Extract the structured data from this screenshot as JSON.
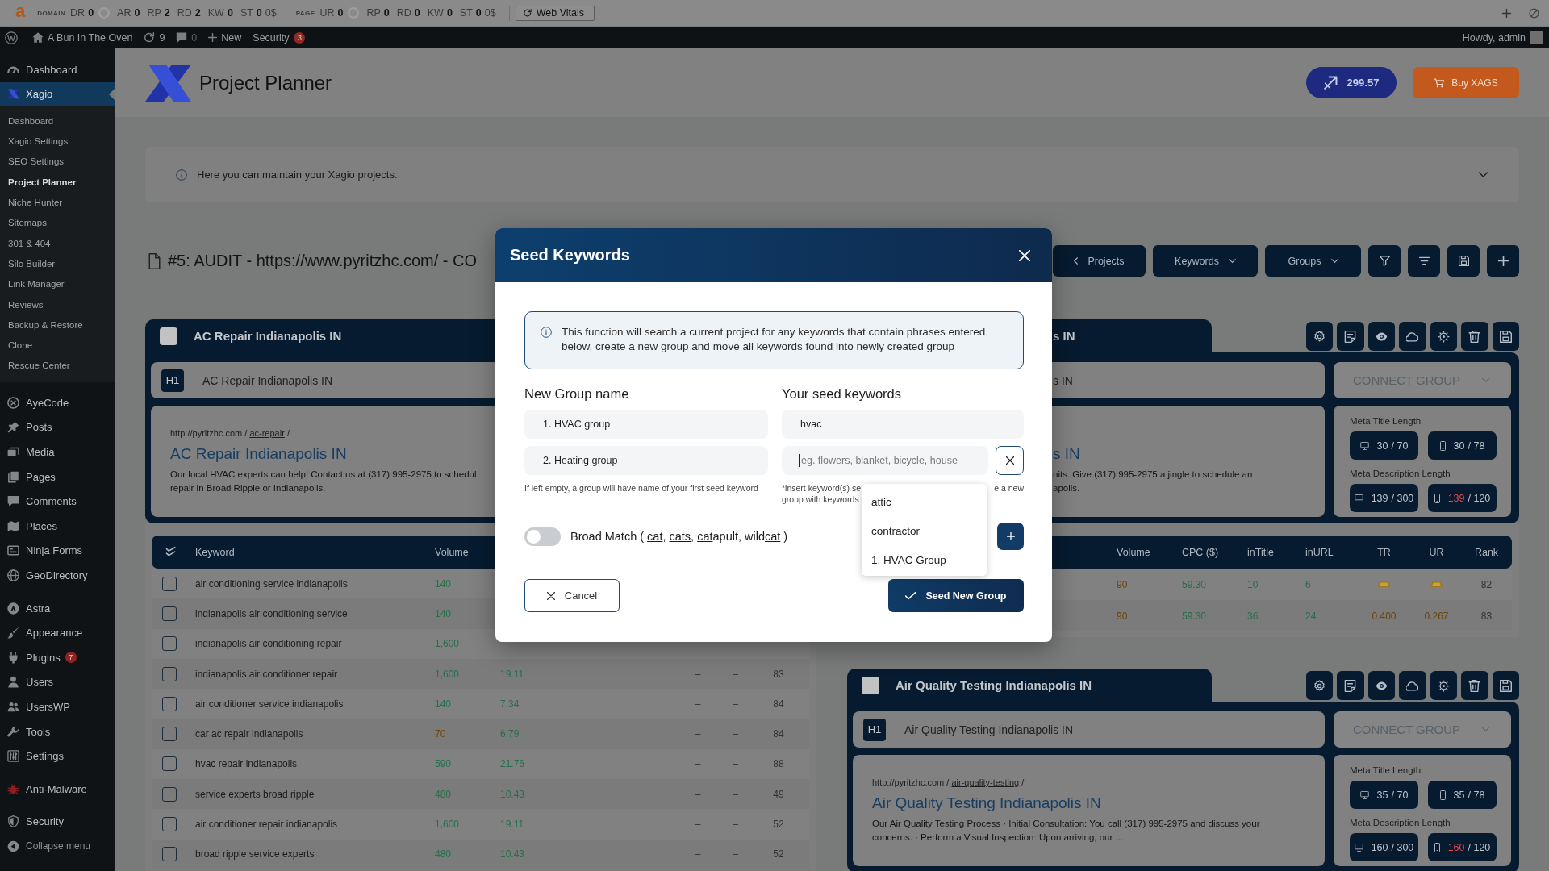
{
  "toolbar": {
    "logo": "a",
    "groups": [
      {
        "label": "DOMAIN",
        "score": {
          "label": "DR",
          "value": "0"
        },
        "metrics": [
          {
            "label": "AR",
            "value": "0"
          },
          {
            "label": "RP",
            "value": "2"
          },
          {
            "label": "RD",
            "value": "2"
          },
          {
            "label": "KW",
            "value": "0"
          },
          {
            "label": "ST",
            "value": "0",
            "extra": "0$"
          }
        ]
      },
      {
        "label": "PAGE",
        "score": {
          "label": "UR",
          "value": "0"
        },
        "metrics": [
          {
            "label": "RP",
            "value": "0"
          },
          {
            "label": "RD",
            "value": "0"
          },
          {
            "label": "KW",
            "value": "0"
          },
          {
            "label": "ST",
            "value": "0",
            "extra": "0$"
          }
        ]
      }
    ],
    "web_vitals": "Web Vitals"
  },
  "admin_bar": {
    "site": "A Bun In The Oven",
    "updates": "9",
    "comments": "0",
    "new": "New",
    "security": "Security",
    "security_count": "3",
    "greeting": "Howdy, admin"
  },
  "sidebar": {
    "groups": [
      [
        {
          "label": "Dashboard",
          "selected": false
        },
        {
          "label": "Xagio",
          "selected": true,
          "children": [
            {
              "label": "Dashboard",
              "selected": false
            },
            {
              "label": "Xagio Settings",
              "selected": false
            },
            {
              "label": "SEO Settings",
              "selected": false
            },
            {
              "label": "Project Planner",
              "selected": true
            },
            {
              "label": "Niche Hunter",
              "selected": false
            },
            {
              "label": "Sitemaps",
              "selected": false
            },
            {
              "label": "301 & 404",
              "selected": false
            },
            {
              "label": "Silo Builder",
              "selected": false
            },
            {
              "label": "Link Manager",
              "selected": false
            },
            {
              "label": "Reviews",
              "selected": false
            },
            {
              "label": "Backup & Restore",
              "selected": false
            },
            {
              "label": "Clone",
              "selected": false
            },
            {
              "label": "Rescue Center",
              "selected": false
            }
          ]
        }
      ],
      [
        {
          "label": "AyeCode",
          "selected": false
        },
        {
          "label": "Posts",
          "selected": false
        },
        {
          "label": "Media",
          "selected": false
        },
        {
          "label": "Pages",
          "selected": false
        },
        {
          "label": "Comments",
          "selected": false
        },
        {
          "label": "Places",
          "selected": false
        },
        {
          "label": "Ninja Forms",
          "selected": false
        },
        {
          "label": "GeoDirectory",
          "selected": false
        }
      ],
      [
        {
          "label": "Astra",
          "selected": false
        },
        {
          "label": "Appearance",
          "selected": false
        },
        {
          "label": "Plugins",
          "selected": false,
          "badge": "7"
        },
        {
          "label": "Users",
          "selected": false
        },
        {
          "label": "UsersWP",
          "selected": false
        },
        {
          "label": "Tools",
          "selected": false
        },
        {
          "label": "Settings",
          "selected": false
        }
      ],
      [
        {
          "label": "Anti-Malware",
          "selected": false
        }
      ],
      [
        {
          "label": "Security",
          "selected": false
        }
      ]
    ],
    "collapse": "Collapse menu"
  },
  "header": {
    "title": "Project Planner",
    "balance": "299.57",
    "buy": "Buy XAGS"
  },
  "notice": {
    "text": "Here you can maintain your Xagio projects."
  },
  "project": {
    "title": "#5: AUDIT - https://www.pyritzhc.com/ - CO",
    "buttons": [
      "Projects",
      "Keywords",
      "Groups"
    ]
  },
  "project_columns": [
    {
      "cards": [
        {
          "title": "AC Repair Indianapolis IN",
          "checked": false,
          "h1_badge": "H1",
          "h1": "AC Repair Indianapolis IN",
          "url": [
            {
              "text": "http://pyritzhc.com / ",
              "underlined": false
            },
            {
              "text": "ac-repair",
              "underlined": true
            },
            {
              "text": " /",
              "underlined": false
            }
          ],
          "snippet_title": "AC Repair Indianapolis IN",
          "description_lines": [
            "Our local HVAC experts can help! Contact us at (317) 995-2975 to schedul",
            "repair in Broad Ripple or Indianapolis."
          ],
          "keywords_table": {
            "columns": [
              "Keyword",
              "Volume"
            ],
            "rows": [
              {
                "checked": false,
                "cells": [
                  {
                    "kind": "text",
                    "text": "air conditioning service indianapolis"
                  },
                  {
                    "kind": "text",
                    "text": "140",
                    "color": "#24704a"
                  }
                ]
              },
              {
                "checked": false,
                "cells": [
                  {
                    "kind": "text",
                    "text": "indianapolis air conditioning service"
                  },
                  {
                    "kind": "text",
                    "text": "140",
                    "color": "#24704a"
                  }
                ]
              },
              {
                "checked": false,
                "cells": [
                  {
                    "kind": "text",
                    "text": "indianapolis air conditioning repair"
                  },
                  {
                    "kind": "text",
                    "text": "1,600",
                    "color": "#24704a"
                  }
                ]
              },
              {
                "checked": false,
                "cells": [
                  {
                    "kind": "text",
                    "text": "indianapolis air conditioner repair"
                  },
                  {
                    "kind": "text",
                    "text": "1,600",
                    "color": "#24704a"
                  },
                  {
                    "kind": "text",
                    "text": "19.11",
                    "color": "#24704a"
                  },
                  {
                    "kind": "text",
                    "text": "–"
                  },
                  {
                    "kind": "text",
                    "text": "–"
                  },
                  {
                    "kind": "text",
                    "text": "83"
                  }
                ]
              },
              {
                "checked": false,
                "cells": [
                  {
                    "kind": "text",
                    "text": "air conditioner service indianapolis"
                  },
                  {
                    "kind": "text",
                    "text": "140",
                    "color": "#24704a"
                  },
                  {
                    "kind": "text",
                    "text": "7.34",
                    "color": "#24704a"
                  },
                  {
                    "kind": "text",
                    "text": "–"
                  },
                  {
                    "kind": "text",
                    "text": "–"
                  },
                  {
                    "kind": "text",
                    "text": "84"
                  }
                ]
              },
              {
                "checked": false,
                "cells": [
                  {
                    "kind": "text",
                    "text": "car ac repair indianapolis"
                  },
                  {
                    "kind": "text",
                    "text": "70",
                    "color": "#6e4306"
                  },
                  {
                    "kind": "text",
                    "text": "6.79",
                    "color": "#24704a"
                  },
                  {
                    "kind": "text",
                    "text": "–"
                  },
                  {
                    "kind": "text",
                    "text": "–"
                  },
                  {
                    "kind": "text",
                    "text": "84"
                  }
                ]
              },
              {
                "checked": false,
                "cells": [
                  {
                    "kind": "text",
                    "text": "hvac repair indianapolis"
                  },
                  {
                    "kind": "text",
                    "text": "590",
                    "color": "#24704a"
                  },
                  {
                    "kind": "text",
                    "text": "21.76",
                    "color": "#24704a"
                  },
                  {
                    "kind": "text",
                    "text": "–"
                  },
                  {
                    "kind": "text",
                    "text": "–"
                  },
                  {
                    "kind": "text",
                    "text": "88"
                  }
                ]
              },
              {
                "checked": false,
                "cells": [
                  {
                    "kind": "text",
                    "text": "service experts broad ripple"
                  },
                  {
                    "kind": "text",
                    "text": "480",
                    "color": "#24704a"
                  },
                  {
                    "kind": "text",
                    "text": "10.43",
                    "color": "#24704a"
                  },
                  {
                    "kind": "text",
                    "text": "–"
                  },
                  {
                    "kind": "text",
                    "text": "–"
                  },
                  {
                    "kind": "text",
                    "text": "49"
                  }
                ]
              },
              {
                "checked": false,
                "cells": [
                  {
                    "kind": "text",
                    "text": "air conditioner repair indianapolis"
                  },
                  {
                    "kind": "text",
                    "text": "1,600",
                    "color": "#24704a"
                  },
                  {
                    "kind": "text",
                    "text": "19.11",
                    "color": "#24704a"
                  },
                  {
                    "kind": "text",
                    "text": "–"
                  },
                  {
                    "kind": "text",
                    "text": "–"
                  },
                  {
                    "kind": "text",
                    "text": "52"
                  }
                ]
              },
              {
                "checked": false,
                "cells": [
                  {
                    "kind": "text",
                    "text": "broad ripple service experts"
                  },
                  {
                    "kind": "text",
                    "text": "480",
                    "color": "#24704a"
                  },
                  {
                    "kind": "text",
                    "text": "10.43",
                    "color": "#24704a"
                  },
                  {
                    "kind": "text",
                    "text": "–"
                  },
                  {
                    "kind": "text",
                    "text": "–"
                  },
                  {
                    "kind": "text",
                    "text": "52"
                  }
                ]
              }
            ]
          }
        }
      ]
    },
    {
      "cards": [
        {
          "title": "s IN",
          "h1": "s IN",
          "snippet_title": "s IN",
          "description_lines": [
            "nits. Give (317) 995-2975 a jingle to schedule an",
            "apolis."
          ],
          "connect_group": "CONNECT GROUP",
          "meta": [
            {
              "label": "Meta Title Length",
              "counts": [
                {
                  "value": "30",
                  "rest": "/ 70",
                  "over": false
                },
                {
                  "value": "30",
                  "rest": "/ 78",
                  "over": false
                }
              ]
            },
            {
              "label": "Meta Description Length",
              "counts": [
                {
                  "value": "139",
                  "rest": "/ 300",
                  "over": false
                },
                {
                  "value": "139",
                  "rest": "/ 120",
                  "over": true
                }
              ]
            }
          ],
          "keywords_table": {
            "columns": [
              "Volume",
              "CPC ($)",
              "inTitle",
              "inURL",
              "TR",
              "UR",
              "Rank"
            ],
            "rows": [
              {
                "cells": [
                  {
                    "kind": "text",
                    "text": "90",
                    "color": "#6e4306"
                  },
                  {
                    "kind": "text",
                    "text": "59.30",
                    "color": "#24704a"
                  },
                  {
                    "kind": "text",
                    "text": "10",
                    "color": "#24704a"
                  },
                  {
                    "kind": "text",
                    "text": "6",
                    "color": "#24704a"
                  },
                  {
                    "kind": "icon"
                  },
                  {
                    "kind": "icon"
                  },
                  {
                    "kind": "text",
                    "text": "82"
                  }
                ]
              },
              {
                "cells": [
                  {
                    "kind": "text",
                    "text": "90",
                    "color": "#6e4306"
                  },
                  {
                    "kind": "text",
                    "text": "59.30",
                    "color": "#24704a"
                  },
                  {
                    "kind": "text",
                    "text": "36",
                    "color": "#24704a"
                  },
                  {
                    "kind": "text",
                    "text": "24",
                    "color": "#24704a"
                  },
                  {
                    "kind": "text",
                    "text": "0.400",
                    "color": "#6e4306"
                  },
                  {
                    "kind": "text",
                    "text": "0.267",
                    "color": "#6e4306"
                  },
                  {
                    "kind": "text",
                    "text": "83"
                  }
                ]
              }
            ]
          }
        },
        {
          "title": "Air Quality Testing Indianapolis IN",
          "checked": false,
          "h1_badge": "H1",
          "h1": "Air Quality Testing Indianapolis IN",
          "url": [
            {
              "text": "http://pyritzhc.com / ",
              "underlined": false
            },
            {
              "text": "air-quality-testing",
              "underlined": true
            },
            {
              "text": " /",
              "underlined": false
            }
          ],
          "snippet_title": "Air Quality Testing Indianapolis IN",
          "description_lines": [
            "Our Air Quality Testing Process · Initial Consultation: You call (317) 995-2975 and discuss your",
            "concerns. · Perform a Visual Inspection: Upon arriving, our ..."
          ],
          "connect_group": "CONNECT GROUP",
          "meta": [
            {
              "label": "Meta Title Length",
              "counts": [
                {
                  "value": "35",
                  "rest": "/ 70",
                  "over": false
                },
                {
                  "value": "35",
                  "rest": "/ 78",
                  "over": false
                }
              ]
            },
            {
              "label": "Meta Description Length",
              "counts": [
                {
                  "value": "160",
                  "rest": "/ 300",
                  "over": false
                },
                {
                  "value": "160",
                  "rest": "/ 120",
                  "over": true
                }
              ]
            }
          ]
        }
      ]
    }
  ],
  "modal": {
    "title": "Seed Keywords",
    "info": "This function will search a current project for any keywords that contain phrases entered below, create a new group and move all keywords found into newly created group",
    "group_heading": "New Group name",
    "group_names": [
      "1. HVAC group",
      "2. Heating group"
    ],
    "group_hint": "If left empty, a group will have name of your first seed keyword",
    "seed_heading": "Your seed keywords",
    "seeds": [
      "hvac"
    ],
    "seed_input": {
      "placeholder": "eg. flowers, blanket, bicycle, house",
      "focused": true
    },
    "seed_hint": [
      "*insert keyword(s) se",
      "e a new",
      "group with keywords"
    ],
    "suggestions": [
      {
        "label": "attic",
        "selected": false
      },
      {
        "label": "contractor",
        "selected": false
      },
      {
        "label": "1. HVAC Group",
        "selected": false
      }
    ],
    "broad_match": {
      "on": false,
      "label": [
        {
          "text": "Broad Match ( ",
          "underlined": false
        },
        {
          "text": "cat",
          "underlined": true
        },
        {
          "text": ", ",
          "underlined": false
        },
        {
          "text": "cats",
          "underlined": true
        },
        {
          "text": ", ",
          "underlined": false
        },
        {
          "text": "cat",
          "underlined": true
        },
        {
          "text": "apult, wild",
          "underlined": false
        },
        {
          "text": "cat",
          "underlined": true
        },
        {
          "text": " )",
          "underlined": false
        }
      ]
    },
    "cancel": "Cancel",
    "submit": "Seed New Group"
  }
}
